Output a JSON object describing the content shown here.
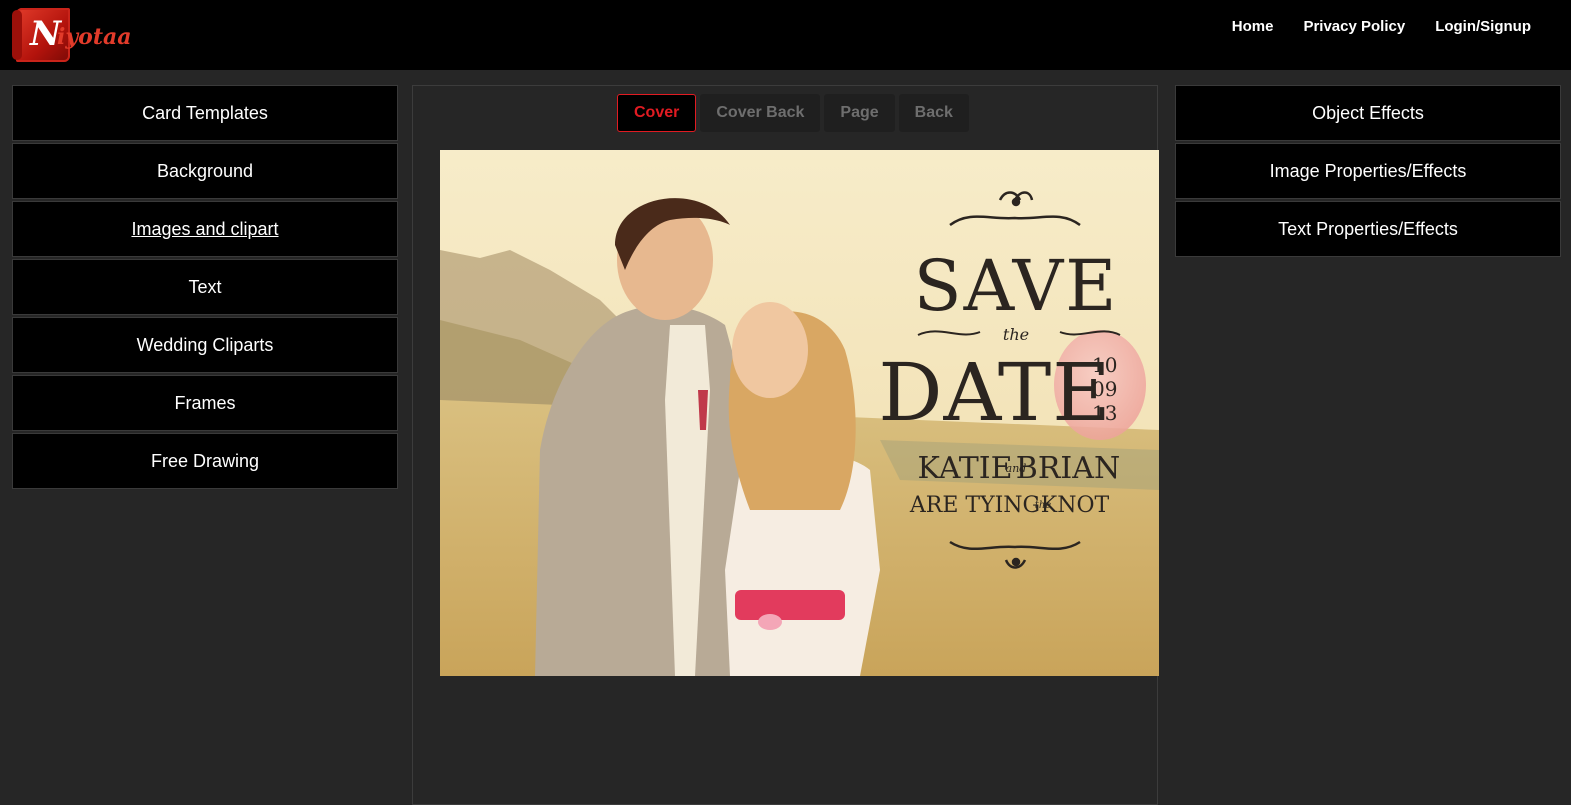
{
  "brand": {
    "logo_letter": "N",
    "logo_rest": "iyotaa",
    "accent": "#e11b22"
  },
  "nav": {
    "home": "Home",
    "privacy": "Privacy Policy",
    "login": "Login/Signup"
  },
  "left_menu": {
    "items": [
      {
        "label": "Card Templates"
      },
      {
        "label": "Background"
      },
      {
        "label": "Images and clipart"
      },
      {
        "label": "Text"
      },
      {
        "label": "Wedding Cliparts"
      },
      {
        "label": "Frames"
      },
      {
        "label": "Free Drawing"
      }
    ]
  },
  "right_menu": {
    "items": [
      {
        "label": "Object Effects"
      },
      {
        "label": "Image Properties/Effects"
      },
      {
        "label": "Text Properties/Effects"
      }
    ]
  },
  "tabs": {
    "items": [
      {
        "label": "Cover"
      },
      {
        "label": "Cover Back"
      },
      {
        "label": "Page"
      },
      {
        "label": "Back"
      }
    ],
    "active": "Cover"
  },
  "card": {
    "save": "SAVE",
    "the1": "the",
    "date": "DATE",
    "d1": "10",
    "d2": "09",
    "d3": "13",
    "names_a": "KATIE",
    "names_amp": "and",
    "names_b": "BRIAN",
    "tying_a": "ARE TYING",
    "tying_the": "the",
    "tying_b": "KNOT"
  }
}
